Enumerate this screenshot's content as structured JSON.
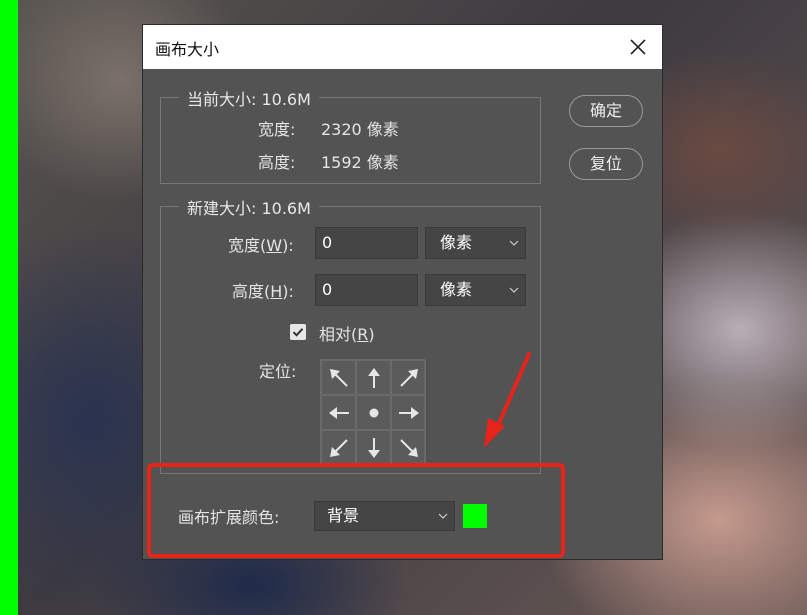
{
  "dialog": {
    "title": "画布大小",
    "current_size": {
      "legend": "当前大小: 10.6M",
      "width_label": "宽度:",
      "width_value": "2320 像素",
      "height_label": "高度:",
      "height_value": "1592 像素"
    },
    "new_size": {
      "legend": "新建大小: 10.6M",
      "width_label_prefix": "宽度(",
      "width_hotkey": "W",
      "width_label_suffix": "):",
      "width_value": "0",
      "width_unit": "像素",
      "height_label_prefix": "高度(",
      "height_hotkey": "H",
      "height_label_suffix": "):",
      "height_value": "0",
      "height_unit": "像素",
      "relative_label_prefix": "相对(",
      "relative_hotkey": "R",
      "relative_label_suffix": ")",
      "relative_checked": true,
      "anchor_label": "定位:"
    },
    "extension_color": {
      "label": "画布扩展颜色:",
      "value": "背景",
      "swatch_color": "#00ff00"
    },
    "buttons": {
      "ok": "确定",
      "reset": "复位"
    }
  },
  "annotation": {
    "highlight_color": "#e8231a"
  }
}
